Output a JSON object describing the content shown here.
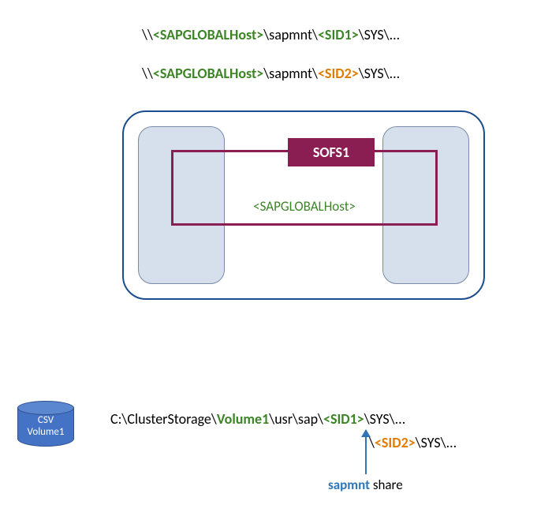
{
  "paths": {
    "p1": {
      "a": "\\\\",
      "b": "<SAPGLOBALHost>",
      "c": "\\sapmnt\\",
      "d": "<SID1>",
      "e": "\\SYS\\..."
    },
    "p2": {
      "a": "\\\\",
      "b": "<SAPGLOBALHost>",
      "c": "\\sapmnt\\",
      "d": "<SID2>",
      "e": "\\SYS\\..."
    }
  },
  "sofs": {
    "label": "SOFS1",
    "host": "<SAPGLOBALHost>"
  },
  "csv": {
    "line1": "CSV",
    "line2": "Volume1"
  },
  "local": {
    "a": "C:\\ClusterStorage\\",
    "vol": "Volume1",
    "b": "\\usr\\sap\\",
    "sid1": "<SID1>",
    "c": "\\SYS\\...",
    "sid2pre": "\\",
    "sid2": "<SID2>",
    "sid2post": "\\SYS\\..."
  },
  "share": {
    "name": "sapmnt",
    "suffix": " share"
  }
}
